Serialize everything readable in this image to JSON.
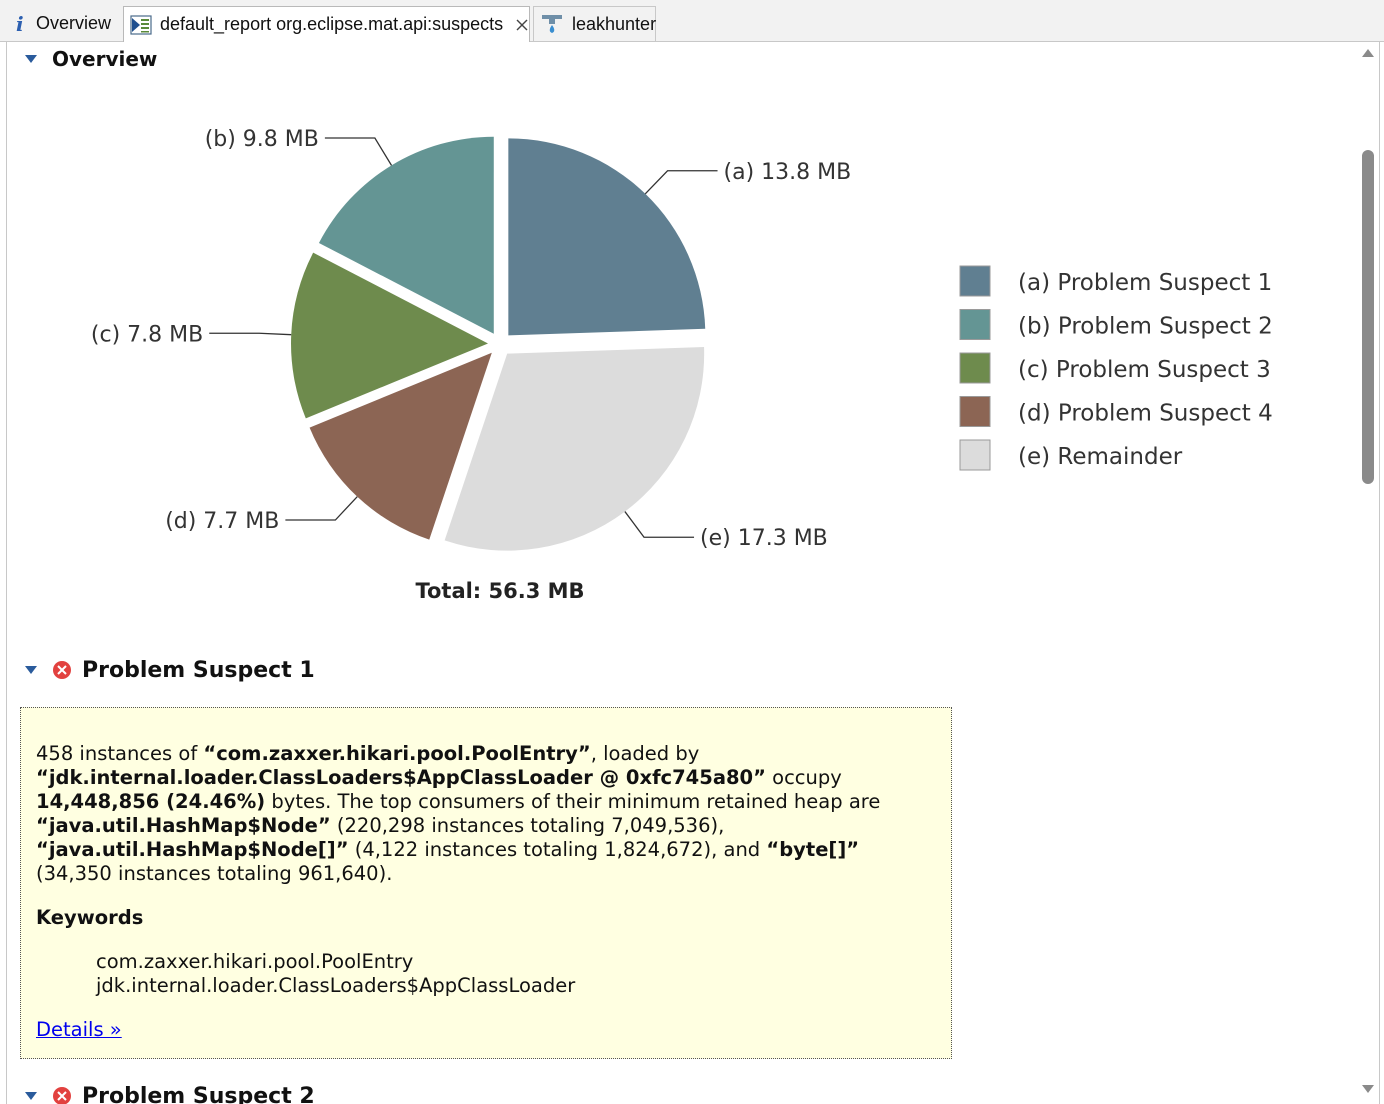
{
  "tabs": [
    {
      "label": "Overview",
      "icon": "info-icon",
      "active": false
    },
    {
      "label": "default_report org.eclipse.mat.api:suspects",
      "icon": "report-icon",
      "active": true,
      "closable": true
    },
    {
      "label": "leakhunter",
      "icon": "leakhunter-icon",
      "active": false
    }
  ],
  "overview": {
    "title": "Overview"
  },
  "chart_data": {
    "type": "pie",
    "title": "",
    "total_label": "Total: 56.3 MB",
    "categories": [
      "Problem Suspect 1",
      "Problem Suspect 2",
      "Problem Suspect 3",
      "Problem Suspect 4",
      "Remainder"
    ],
    "keys": [
      "(a)",
      "(b)",
      "(c)",
      "(d)",
      "(e)"
    ],
    "values": [
      13.8,
      9.8,
      7.8,
      7.7,
      17.3
    ],
    "value_labels": [
      "13.8 MB",
      "9.8 MB",
      "7.8 MB",
      "7.7 MB",
      "17.3 MB"
    ],
    "legend": [
      "Problem Suspect 1",
      "Problem Suspect 2",
      "Problem Suspect 3",
      "Problem Suspect 4",
      "Remainder"
    ],
    "colors": [
      "#607f91",
      "#649594",
      "#6e8b4d",
      "#8c6554",
      "#dcdcdc"
    ],
    "legend_placement": "right",
    "exploded": true
  },
  "suspect1": {
    "title": "Problem Suspect 1",
    "desc": {
      "t1": "458 instances of ",
      "b1": "“com.zaxxer.hikari.pool.PoolEntry”",
      "t2": ", loaded by ",
      "b2": "“jdk.internal.loader.ClassLoaders$AppClassLoader @ 0xfc745a80”",
      "t3": " occupy ",
      "b3": "14,448,856 (24.46%)",
      "t4": " bytes. The top consumers of their minimum retained heap are ",
      "b4": "“java.util.HashMap$Node”",
      "t5": " (220,298 instances totaling 7,049,536), ",
      "b5": "“java.util.HashMap$Node[]”",
      "t6": " (4,122 instances totaling 1,824,672), and ",
      "b6": "“byte[]”",
      "t7": " (34,350 instances totaling 961,640)."
    },
    "keywords_title": "Keywords",
    "keywords": [
      "com.zaxxer.hikari.pool.PoolEntry",
      "jdk.internal.loader.ClassLoaders$AppClassLoader"
    ],
    "details_link": "Details »"
  },
  "suspect2": {
    "title": "Problem Suspect 2"
  }
}
